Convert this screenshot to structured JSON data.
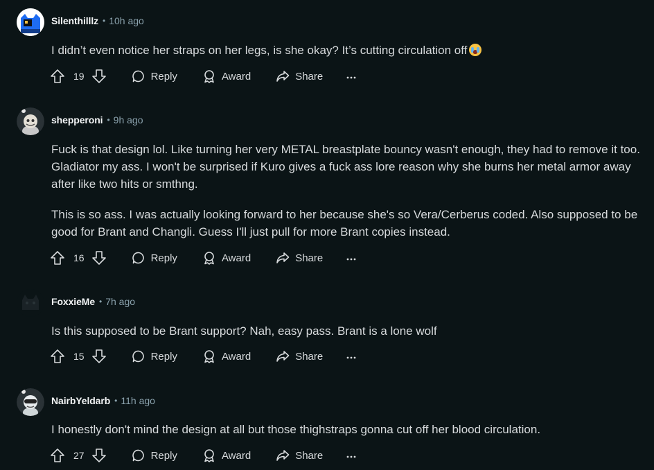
{
  "labels": {
    "reply": "Reply",
    "award": "Award",
    "share": "Share",
    "separator": "•"
  },
  "comments": [
    {
      "author": "Silenthilllz",
      "time": "10h ago",
      "paragraphs": [
        "I didn’t even notice her straps on her legs, is she okay? It’s cutting circulation off"
      ],
      "emoji": "loudly-crying-face-emoji",
      "score": "19"
    },
    {
      "author": "shepperoni",
      "time": "9h ago",
      "paragraphs": [
        "Fuck is that design lol. Like turning her very METAL breastplate bouncy wasn't enough, they had to remove it too. Gladiator my ass. I won't be surprised if Kuro gives a fuck ass lore reason why she burns her metal armor away after like two hits or smthng.",
        "This is so ass. I was actually looking forward to her because she's so Vera/Cerberus coded. Also supposed to be good for Brant and Changli. Guess I'll just pull for more Brant copies instead."
      ],
      "score": "16"
    },
    {
      "author": "FoxxieMe",
      "time": "7h ago",
      "paragraphs": [
        "Is this supposed to be Brant support? Nah, easy pass. Brant is a lone wolf"
      ],
      "score": "15"
    },
    {
      "author": "NairbYeldarb",
      "time": "11h ago",
      "paragraphs": [
        "I honestly don't mind the design at all but those thighstraps gonna cut off her blood circulation."
      ],
      "score": "27"
    }
  ],
  "colors": {
    "background": "#0b1416",
    "text": "#d7dadc",
    "meta": "#8ba2ad",
    "avatar1": "#1e6cf2"
  }
}
